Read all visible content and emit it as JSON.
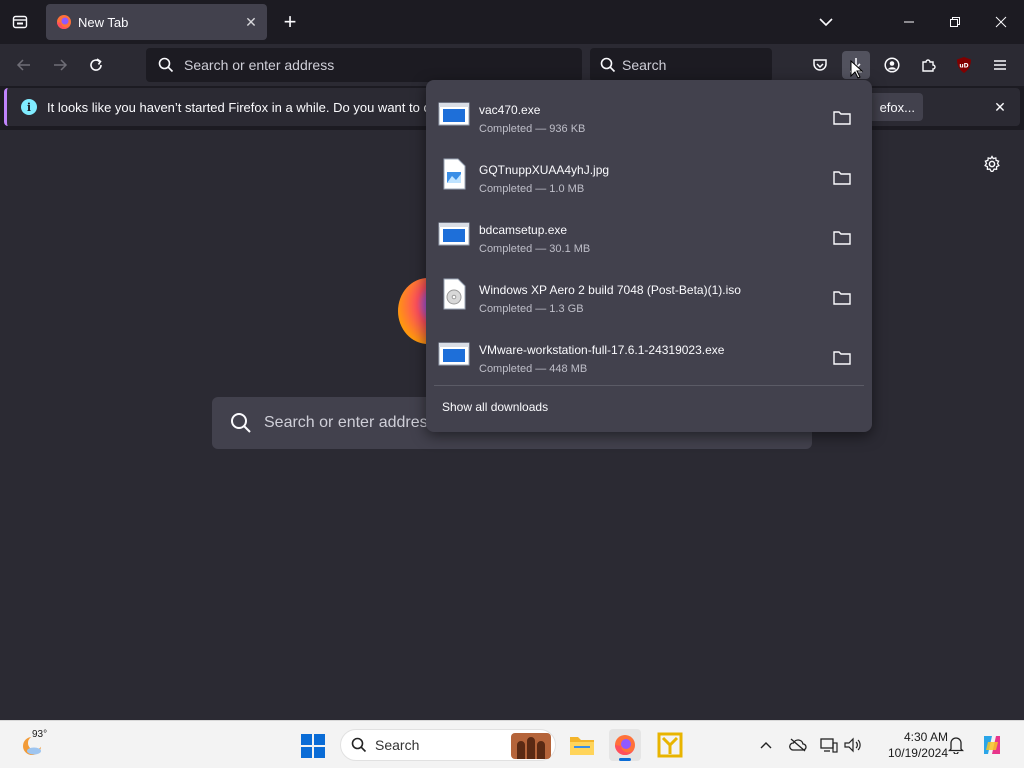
{
  "browser": {
    "tab": {
      "title": "New Tab"
    },
    "urlbar": {
      "placeholder": "Search or enter address"
    },
    "searchbar": {
      "placeholder": "Search"
    },
    "notification": {
      "message": "It looks like you haven’t started Firefox in a while. Do you want to clean it",
      "button_label": "efox..."
    },
    "newtab": {
      "search_placeholder": "Search or enter address"
    }
  },
  "downloads": {
    "items": [
      {
        "name": "vac470.exe",
        "status": "Completed — 936 KB",
        "icon": "exe-icon"
      },
      {
        "name": "GQTnuppXUAA4yhJ.jpg",
        "status": "Completed — 1.0 MB",
        "icon": "image-icon"
      },
      {
        "name": "bdcamsetup.exe",
        "status": "Completed — 30.1 MB",
        "icon": "exe-icon"
      },
      {
        "name": "Windows XP Aero 2 build 7048 (Post-Beta)(1).iso",
        "status": "Completed — 1.3 GB",
        "icon": "disc-icon"
      },
      {
        "name": "VMware-workstation-full-17.6.1-24319023.exe",
        "status": "Completed — 448 MB",
        "icon": "exe-icon"
      }
    ],
    "show_all_label": "Show all downloads"
  },
  "taskbar": {
    "weather_temp": "93°",
    "search_placeholder": "Search",
    "time": "4:30 AM",
    "date": "10/19/2024"
  },
  "colors": {
    "frame": "#1c1b22",
    "toolbar": "#2b2a33",
    "panel": "#42414d",
    "accent": "#c084fc"
  }
}
